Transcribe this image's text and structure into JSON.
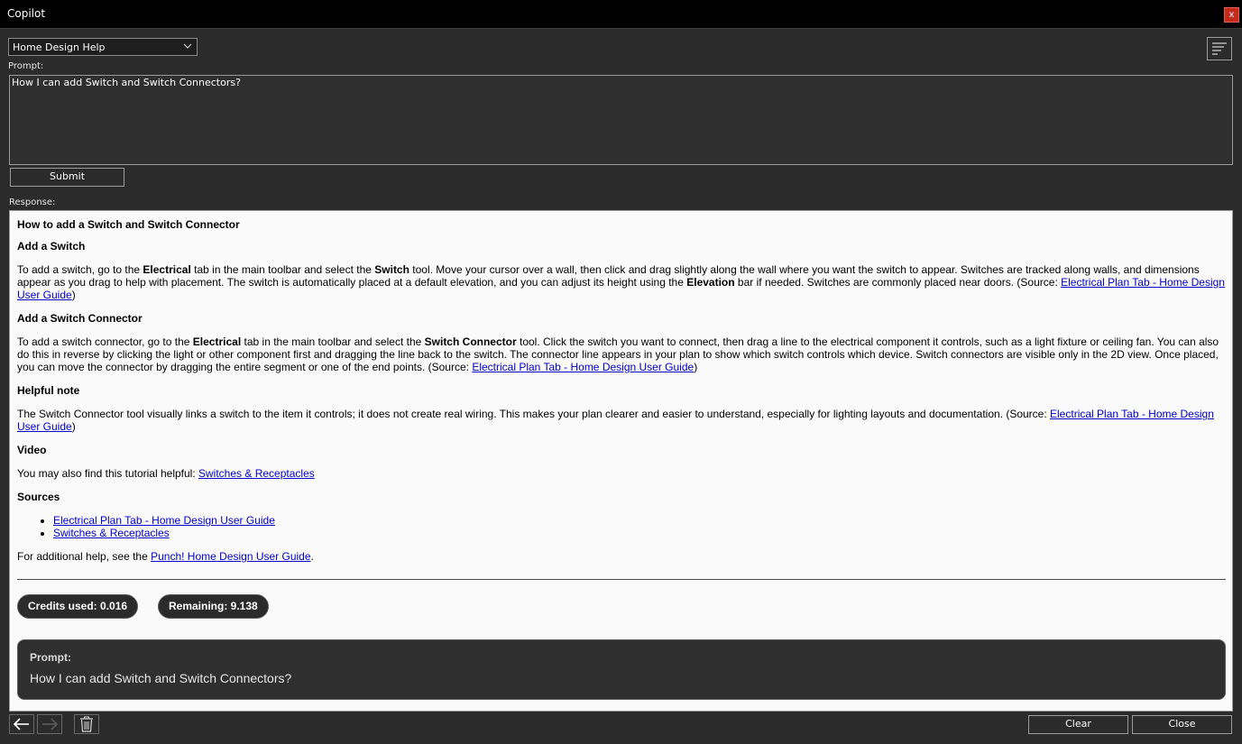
{
  "window": {
    "title": "Copilot",
    "close_label": "x"
  },
  "mode_select": {
    "value": "Home Design Help"
  },
  "prompt": {
    "label": "Prompt:",
    "value": "How I can add Switch and Switch Connectors?"
  },
  "submit_label": "Submit",
  "response_label": "Response:",
  "response": {
    "title": "How to add a Switch and Switch Connector",
    "sec1": {
      "heading": "Add a Switch",
      "t1": "To add a switch, go to the ",
      "b1": "Electrical",
      "t2": " tab in the main toolbar and select the ",
      "b2": "Switch",
      "t3": " tool. Move your cursor over a wall, then click and drag slightly along the wall where you want the switch to appear. Switches are tracked along walls, and dimensions appear as you drag to help with placement. The switch is automatically placed at a default elevation, and you can adjust its height using the ",
      "b3": "Elevation",
      "t4": " bar if needed. Switches are commonly placed near doors. (Source: ",
      "link": "Electrical Plan Tab - Home Design User Guide",
      "t5": ")"
    },
    "sec2": {
      "heading": "Add a Switch Connector",
      "t1": "To add a switch connector, go to the ",
      "b1": "Electrical",
      "t2": " tab in the main toolbar and select the ",
      "b2": "Switch Connector",
      "t3": " tool. Click the switch you want to connect, then drag a line to the electrical component it controls, such as a light fixture or ceiling fan. You can also do this in reverse by clicking the light or other component first and dragging the line back to the switch. The connector line appears in your plan to show which switch controls which device. Switch connectors are visible only in the 2D view. Once placed, you can move the connector by dragging the entire segment or one of the end points. (Source: ",
      "link": "Electrical Plan Tab - Home Design User Guide",
      "t4": ")"
    },
    "sec3": {
      "heading": "Helpful note",
      "t1": "The Switch Connector tool visually links a switch to the item it controls; it does not create real wiring. This makes your plan clearer and easier to understand, especially for lighting layouts and documentation. (Source: ",
      "link": "Electrical Plan Tab - Home Design User Guide",
      "t2": ")"
    },
    "sec4": {
      "heading": "Video",
      "t1": "You may also find this tutorial helpful: ",
      "link": "Switches & Receptacles"
    },
    "sources": {
      "heading": "Sources",
      "items": [
        "Electrical Plan Tab - Home Design User Guide",
        "Switches & Receptacles"
      ]
    },
    "footer": {
      "t1": "For additional help, see the ",
      "link": "Punch! Home Design User Guide",
      "t2": "."
    },
    "credits_used": "Credits used: 0.016",
    "remaining": "Remaining: 9.138",
    "bubble_label": "Prompt:",
    "bubble_text": "How I can add Switch and Switch Connectors?"
  },
  "buttons": {
    "clear": "Clear",
    "close": "Close"
  },
  "icons": {
    "back": "arrow-left-icon",
    "forward": "arrow-right-icon",
    "delete": "trash-icon",
    "menu": "menu-lines-icon",
    "dropdown": "chevron-down-icon"
  }
}
